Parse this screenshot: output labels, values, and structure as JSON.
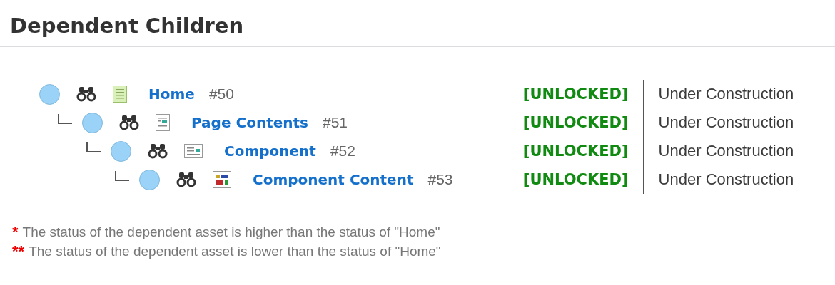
{
  "title": "Dependent Children",
  "tree": [
    {
      "name": "Home",
      "id": "#50",
      "kind": "page",
      "lock": "[UNLOCKED]",
      "status": "Under Construction",
      "children": [
        {
          "name": "Page Contents",
          "id": "#51",
          "kind": "page_contents",
          "lock": "[UNLOCKED]",
          "status": "Under Construction",
          "children": [
            {
              "name": "Component",
              "id": "#52",
              "kind": "component",
              "lock": "[UNLOCKED]",
              "status": "Under Construction",
              "children": [
                {
                  "name": "Component Content",
                  "id": "#53",
                  "kind": "component_content",
                  "lock": "[UNLOCKED]",
                  "status": "Under Construction"
                }
              ]
            }
          ]
        }
      ]
    }
  ],
  "footnotes": [
    {
      "marker": "*",
      "text": "The status of the dependent asset is higher than the status of \"Home\""
    },
    {
      "marker": "**",
      "text": "The status of the dependent asset is lower than the status of \"Home\""
    }
  ]
}
